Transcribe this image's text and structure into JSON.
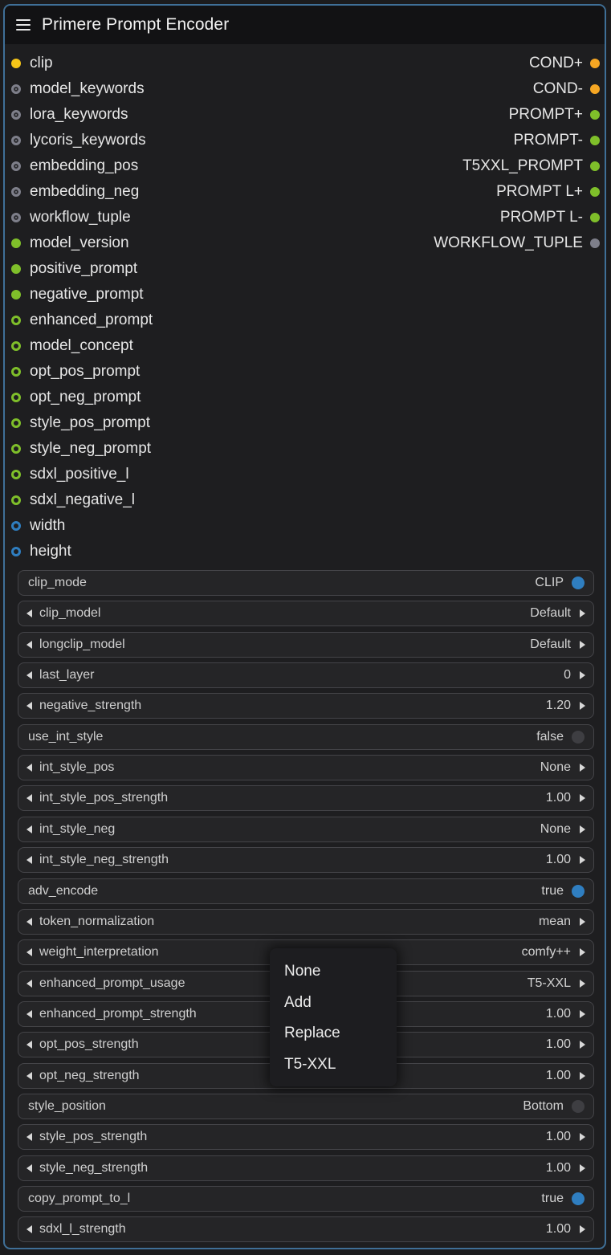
{
  "node": {
    "title": "Primere Prompt Encoder"
  },
  "inputs": [
    {
      "name": "clip",
      "color": "#f5c518",
      "style": "filled"
    },
    {
      "name": "model_keywords",
      "color": "#7e7f8a",
      "style": "ring-dark"
    },
    {
      "name": "lora_keywords",
      "color": "#7e7f8a",
      "style": "ring-dark"
    },
    {
      "name": "lycoris_keywords",
      "color": "#7e7f8a",
      "style": "ring-dark"
    },
    {
      "name": "embedding_pos",
      "color": "#7e7f8a",
      "style": "ring-dark"
    },
    {
      "name": "embedding_neg",
      "color": "#7e7f8a",
      "style": "ring-dark"
    },
    {
      "name": "workflow_tuple",
      "color": "#7e7f8a",
      "style": "ring-dark"
    },
    {
      "name": "model_version",
      "color": "#7fbf2a",
      "style": "filled"
    },
    {
      "name": "positive_prompt",
      "color": "#7fbf2a",
      "style": "filled"
    },
    {
      "name": "negative_prompt",
      "color": "#7fbf2a",
      "style": "filled"
    },
    {
      "name": "enhanced_prompt",
      "color": "#7fbf2a",
      "style": "ring"
    },
    {
      "name": "model_concept",
      "color": "#7fbf2a",
      "style": "ring"
    },
    {
      "name": "opt_pos_prompt",
      "color": "#7fbf2a",
      "style": "ring"
    },
    {
      "name": "opt_neg_prompt",
      "color": "#7fbf2a",
      "style": "ring"
    },
    {
      "name": "style_pos_prompt",
      "color": "#7fbf2a",
      "style": "ring"
    },
    {
      "name": "style_neg_prompt",
      "color": "#7fbf2a",
      "style": "ring"
    },
    {
      "name": "sdxl_positive_l",
      "color": "#7fbf2a",
      "style": "ring"
    },
    {
      "name": "sdxl_negative_l",
      "color": "#7fbf2a",
      "style": "ring"
    },
    {
      "name": "width",
      "color": "#2f7ec0",
      "style": "ring"
    },
    {
      "name": "height",
      "color": "#2f7ec0",
      "style": "ring"
    }
  ],
  "outputs": [
    {
      "name": "COND+",
      "color": "#f5a623",
      "style": "filled"
    },
    {
      "name": "COND-",
      "color": "#f5a623",
      "style": "filled"
    },
    {
      "name": "PROMPT+",
      "color": "#7fbf2a",
      "style": "filled"
    },
    {
      "name": "PROMPT-",
      "color": "#7fbf2a",
      "style": "filled"
    },
    {
      "name": "T5XXL_PROMPT",
      "color": "#7fbf2a",
      "style": "filled"
    },
    {
      "name": "PROMPT L+",
      "color": "#7fbf2a",
      "style": "filled"
    },
    {
      "name": "PROMPT L-",
      "color": "#7fbf2a",
      "style": "filled"
    },
    {
      "name": "WORKFLOW_TUPLE",
      "color": "#7e7f8a",
      "style": "filled"
    }
  ],
  "widgets": [
    {
      "label": "clip_mode",
      "value": "CLIP",
      "kind": "toggle",
      "on": true
    },
    {
      "label": "clip_model",
      "value": "Default",
      "kind": "combo"
    },
    {
      "label": "longclip_model",
      "value": "Default",
      "kind": "combo"
    },
    {
      "label": "last_layer",
      "value": "0",
      "kind": "number"
    },
    {
      "label": "negative_strength",
      "value": "1.20",
      "kind": "number"
    },
    {
      "label": "use_int_style",
      "value": "false",
      "kind": "toggle",
      "on": false
    },
    {
      "label": "int_style_pos",
      "value": "None",
      "kind": "combo"
    },
    {
      "label": "int_style_pos_strength",
      "value": "1.00",
      "kind": "number"
    },
    {
      "label": "int_style_neg",
      "value": "None",
      "kind": "combo"
    },
    {
      "label": "int_style_neg_strength",
      "value": "1.00",
      "kind": "number"
    },
    {
      "label": "adv_encode",
      "value": "true",
      "kind": "toggle",
      "on": true
    },
    {
      "label": "token_normalization",
      "value": "mean",
      "kind": "combo"
    },
    {
      "label": "weight_interpretation",
      "value": "comfy++",
      "kind": "combo"
    },
    {
      "label": "enhanced_prompt_usage",
      "value": "T5-XXL",
      "kind": "combo"
    },
    {
      "label": "enhanced_prompt_strength",
      "value": "1.00",
      "kind": "number"
    },
    {
      "label": "opt_pos_strength",
      "value": "1.00",
      "kind": "number"
    },
    {
      "label": "opt_neg_strength",
      "value": "1.00",
      "kind": "number"
    },
    {
      "label": "style_position",
      "value": "Bottom",
      "kind": "toggle",
      "on": false
    },
    {
      "label": "style_pos_strength",
      "value": "1.00",
      "kind": "number"
    },
    {
      "label": "style_neg_strength",
      "value": "1.00",
      "kind": "number"
    },
    {
      "label": "copy_prompt_to_l",
      "value": "true",
      "kind": "toggle",
      "on": true
    },
    {
      "label": "sdxl_l_strength",
      "value": "1.00",
      "kind": "number"
    }
  ],
  "dropdown": {
    "for": "enhanced_prompt_usage",
    "options": [
      "None",
      "Add",
      "Replace",
      "T5-XXL"
    ]
  }
}
